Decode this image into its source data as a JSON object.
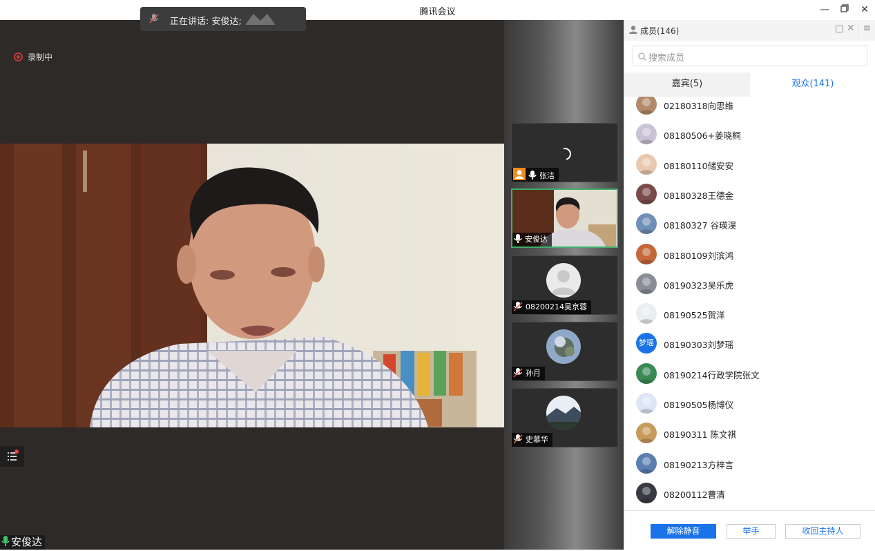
{
  "window": {
    "title": "腾讯会议"
  },
  "speaking": {
    "text": "正在讲话: 安俊达;"
  },
  "recording": {
    "label": "录制中"
  },
  "main_speaker": {
    "name": "安俊达"
  },
  "tiles": [
    {
      "name": "张洁"
    },
    {
      "name": "安俊达"
    },
    {
      "name": "08200214吴京蓉"
    },
    {
      "name": "孙月"
    },
    {
      "name": "史慕华"
    }
  ],
  "panel": {
    "title": "成员(146)",
    "search_placeholder": "搜索成员",
    "tabs": {
      "guests": "嘉宾(5)",
      "audience": "观众(141)"
    },
    "members": [
      {
        "name": "02180318向思维",
        "color": "#b28a6b"
      },
      {
        "name": "08180506+姜晓桐",
        "color": "#c9c3d6"
      },
      {
        "name": "08180110储安安",
        "color": "#e8c9b0"
      },
      {
        "name": "08180328王德金",
        "color": "#7a4b4b"
      },
      {
        "name": "08180327 谷瑛淏",
        "color": "#6f8fb5"
      },
      {
        "name": "08180109刘滨鸿",
        "color": "#c4683a"
      },
      {
        "name": "08190323吴乐虎",
        "color": "#8a8d96"
      },
      {
        "name": "08190525贺洋",
        "color": "#e9eef0"
      },
      {
        "name": "08190303刘梦瑶",
        "color": "#1a73e8",
        "badge": "梦瑶"
      },
      {
        "name": "08190214行政学院张文",
        "color": "#3b8a56"
      },
      {
        "name": "08190505杨博仪",
        "color": "#dde6f7"
      },
      {
        "name": "08190311 陈文祺",
        "color": "#c89b5d"
      },
      {
        "name": "08190213方梓言",
        "color": "#5b7fb0"
      },
      {
        "name": "08200112曹清",
        "color": "#3a3a44"
      }
    ],
    "footer": {
      "unmute": "解除静音",
      "raise": "举手",
      "reclaim": "收回主持人"
    }
  },
  "colors": {
    "accent": "#1a73e8",
    "active_border": "#3fae6b",
    "record": "#c13a3a"
  }
}
